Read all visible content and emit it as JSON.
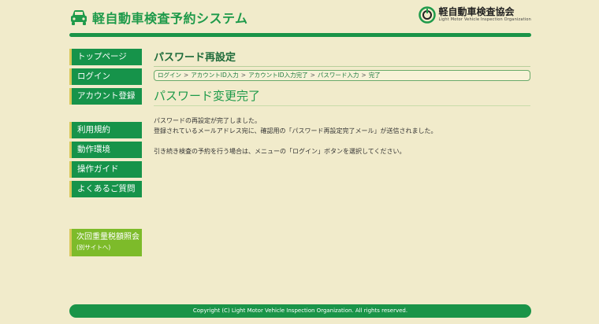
{
  "header": {
    "title": "軽自動車検査予約システム",
    "org_name": "軽自動車検査協会",
    "org_name_en": "Light Motor Vehicle Inspection Organization",
    "brand_color": "#1a9448"
  },
  "sidebar": {
    "group1": [
      "トップページ",
      "ログイン",
      "アカウント登録"
    ],
    "group2": [
      "利用規約",
      "動作環境",
      "操作ガイド",
      "よくあるご質問"
    ],
    "external": {
      "label": "次回重量税額照会",
      "sub": "(別サイトへ)"
    }
  },
  "main": {
    "page_title": "パスワード再設定",
    "breadcrumb": [
      "ログイン",
      "アカウントID入力",
      "アカウントID入力完了",
      "パスワード入力",
      "完了"
    ],
    "breadcrumb_sep": ">",
    "heading": "パスワード変更完了",
    "lines": [
      "パスワードの再設定が完了しました。",
      "登録されているメールアドレス宛に、確認用の「パスワード再設定完了メール」が送信されました。",
      "引き続き検査の予約を行う場合は、メニューの「ログイン」ボタンを選択してください。"
    ]
  },
  "footer": {
    "copyright": "Copyright (C) Light Motor Vehicle Inspection Organization. All rights reserved."
  },
  "icons": {
    "brand": "car-icon",
    "org": "org-logo-icon"
  }
}
